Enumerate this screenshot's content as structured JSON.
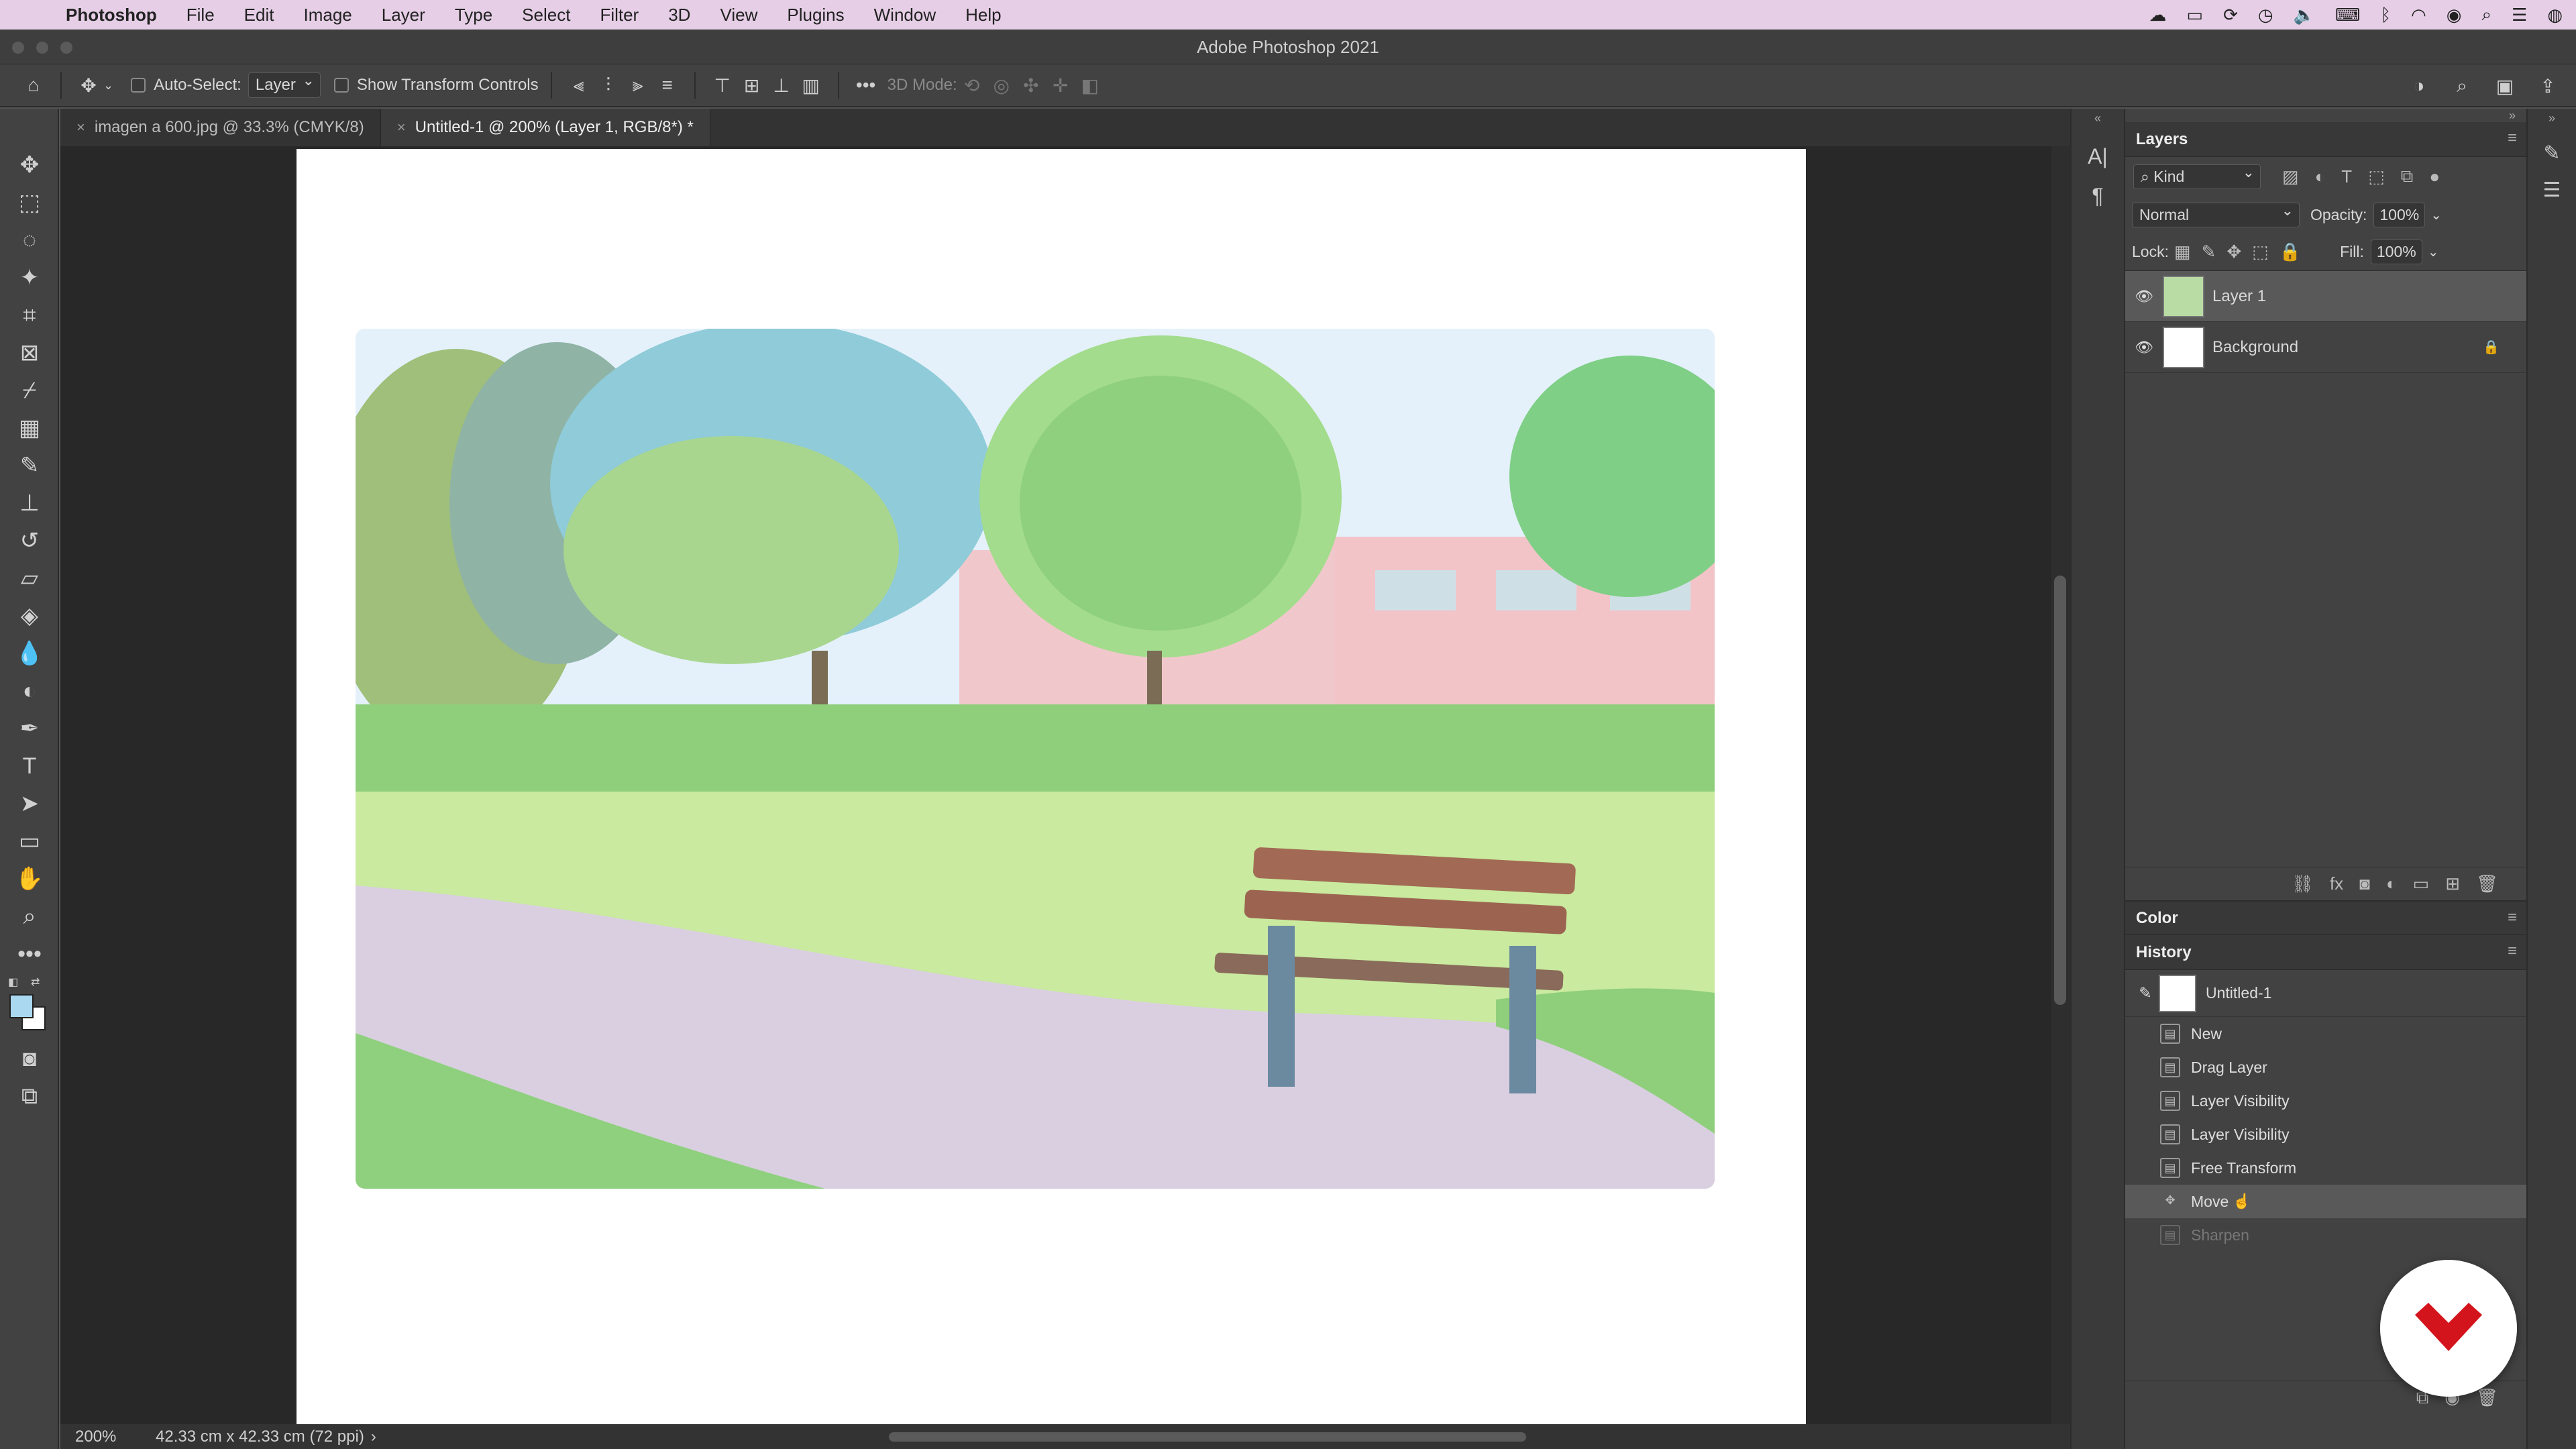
{
  "menubar": {
    "app": "Photoshop",
    "items": [
      "File",
      "Edit",
      "Image",
      "Layer",
      "Type",
      "Select",
      "Filter",
      "3D",
      "View",
      "Plugins",
      "Window",
      "Help"
    ]
  },
  "window": {
    "title": "Adobe Photoshop 2021"
  },
  "options": {
    "auto_select_label": "Auto-Select:",
    "auto_select_value": "Layer",
    "show_transform_label": "Show Transform Controls",
    "mode_3d_label": "3D Mode:"
  },
  "tabs": [
    {
      "label": "imagen a 600.jpg @ 33.3% (CMYK/8)",
      "active": false
    },
    {
      "label": "Untitled-1 @ 200% (Layer 1, RGB/8*) *",
      "active": true
    }
  ],
  "status": {
    "zoom": "200%",
    "doc_info": "42.33 cm x 42.33 cm (72 ppi)"
  },
  "layers_panel": {
    "title": "Layers",
    "filter_kind": "Kind",
    "blend_mode": "Normal",
    "opacity_label": "Opacity:",
    "opacity_value": "100%",
    "lock_label": "Lock:",
    "fill_label": "Fill:",
    "fill_value": "100%",
    "layers": [
      {
        "name": "Layer 1",
        "selected": true
      },
      {
        "name": "Background",
        "selected": false
      }
    ]
  },
  "color_panel": {
    "title": "Color"
  },
  "history_panel": {
    "title": "History",
    "snapshot": "Untitled-1",
    "states": [
      "New",
      "Drag Layer",
      "Layer Visibility",
      "Layer Visibility",
      "Free Transform",
      "Move",
      "Sharpen"
    ],
    "active_state": "Move"
  },
  "colors": {
    "foreground": "#a9d8f0",
    "background": "#ffffff",
    "logo_red": "#d4141c"
  }
}
